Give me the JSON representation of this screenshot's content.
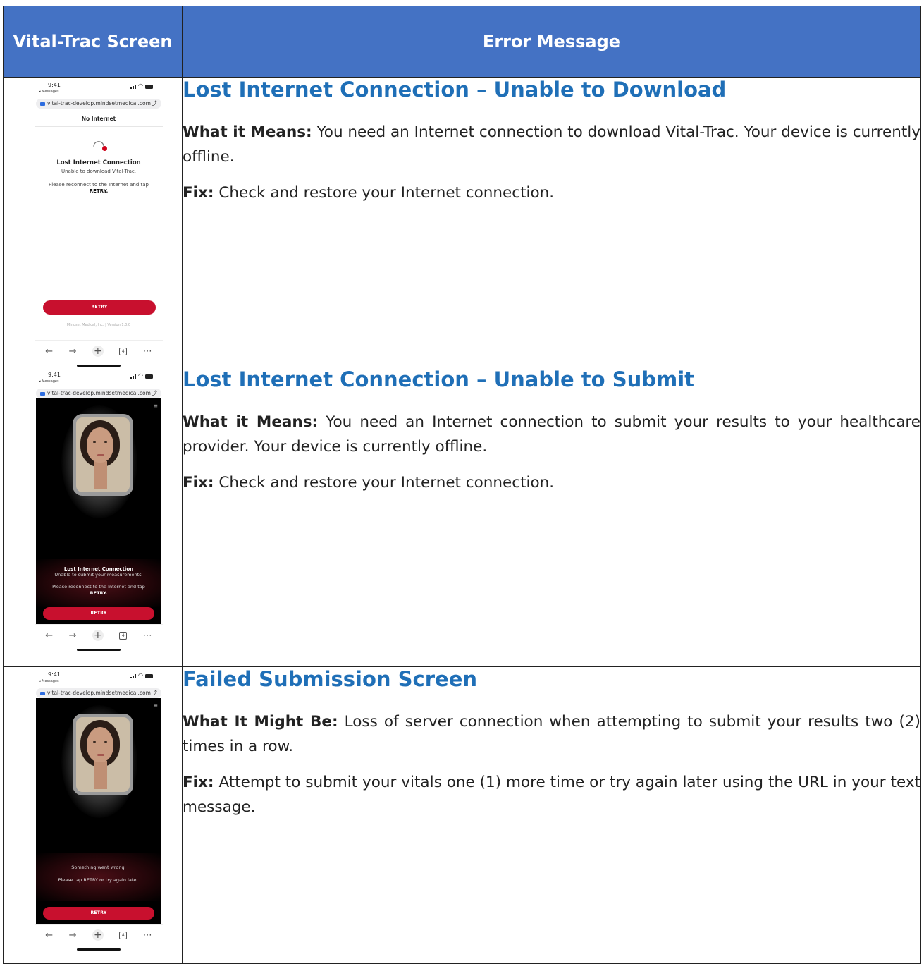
{
  "table": {
    "col_screen": "Vital-Trac Screen",
    "col_message": "Error Message"
  },
  "phone_common": {
    "time": "9:41",
    "back_label": "◂ Messages",
    "url": "vital-trac-develop.mindsetmedical.com",
    "tab_count": "4",
    "retry_label": "RETRY"
  },
  "screens": [
    {
      "page_title": "No Internet",
      "heading": "Lost Internet Connection",
      "line1": "Unable to download Vital-Trac.",
      "line2": "Please reconnect to the Internet and tap",
      "line3": "RETRY.",
      "footer": "Mindset Medical, Inc. | Version 1.0.0"
    },
    {
      "heading": "Lost Internet Connection",
      "line1": "Unable to submit your measurements.",
      "line2": "Please reconnect to the Internet and tap",
      "line3": "RETRY."
    },
    {
      "line1": "Something went wrong.",
      "line2": "Please tap RETRY or try again later."
    }
  ],
  "errors": [
    {
      "title": "Lost Internet Connection – Unable to Download",
      "meaning_label": "What it Means:",
      "meaning": " You need an Internet connection to download Vital-Trac. Your device is currently offline.",
      "fix_label": "Fix:",
      "fix": " Check and restore your Internet connection."
    },
    {
      "title": "Lost Internet Connection – Unable to Submit",
      "meaning_label": "What it Means:",
      "meaning": " You need an Internet connection to submit your results to your healthcare provider. Your device is currently offline.",
      "fix_label": "Fix:",
      "fix": " Check and restore your Internet connection."
    },
    {
      "title": "Failed Submission Screen",
      "meaning_label": "What It Might Be:",
      "meaning": " Loss of server connection when attempting to submit your results two (2) times in a row.",
      "fix_label": "Fix:",
      "fix": " Attempt to submit your vitals one (1) more time or try again later using the URL in your text message."
    }
  ]
}
